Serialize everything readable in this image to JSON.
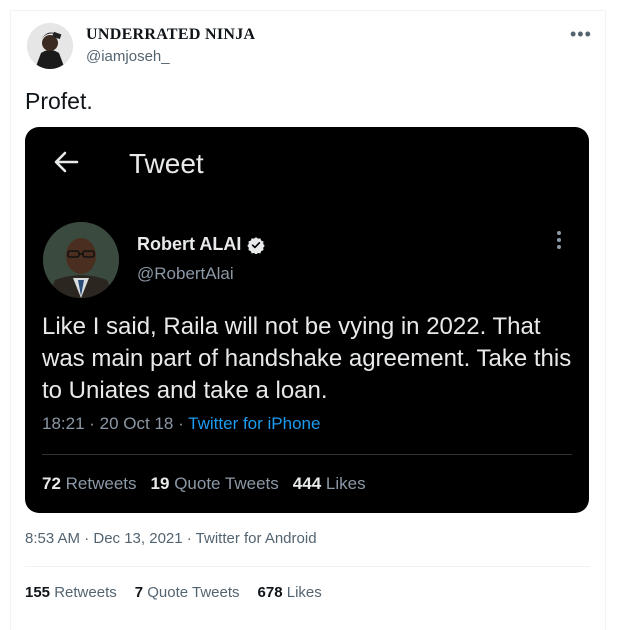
{
  "author": {
    "name": "UNDERRATED NINJA",
    "handle": "@iamjoseh_"
  },
  "tweet": {
    "text": "Profet.",
    "timestamp": "8:53 AM · Dec 13, 2021 · Twitter for Android",
    "stats": {
      "retweets_count": "155",
      "retweets_label": "Retweets",
      "quotes_count": "7",
      "quotes_label": "Quote Tweets",
      "likes_count": "678",
      "likes_label": "Likes"
    }
  },
  "embedded": {
    "header_title": "Tweet",
    "author_name": "Robert ALAI",
    "author_handle": "@RobertAlai",
    "text": "Like I said, Raila will not be vying in 2022. That was main part of handshake agreement. Take this to Uniates and take a loan.",
    "time": "18:21 · 20 Oct 18 · ",
    "source": "Twitter for iPhone",
    "stats": {
      "retweets_count": "72",
      "retweets_label": "Retweets",
      "quotes_count": "19",
      "quotes_label": "Quote Tweets",
      "likes_count": "444",
      "likes_label": "Likes"
    }
  },
  "icons": {
    "more": "more-horizontal-icon",
    "back": "arrow-left-icon",
    "verified": "verified-badge-icon",
    "inner_more": "more-vertical-icon"
  },
  "colors": {
    "accent": "#1d9bf0",
    "secondary_text": "#536471",
    "card_bg": "#000000"
  }
}
